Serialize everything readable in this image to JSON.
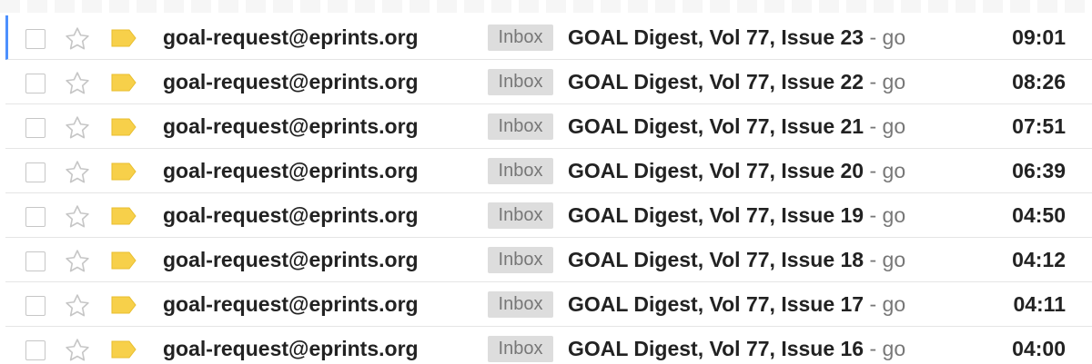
{
  "colors": {
    "star_outline": "#c6c6c6",
    "label_yellow": "#f7d04a",
    "selection_accent": "#4d90fe",
    "badge_bg": "#dddddd",
    "badge_text": "#777777"
  },
  "icons": {
    "checkbox": "checkbox-icon",
    "star": "star-icon",
    "label": "label-marker-icon"
  },
  "messages": [
    {
      "sender": "goal-request@eprints.org",
      "label": "Inbox",
      "subject": "GOAL Digest, Vol 77, Issue 23",
      "snippet": " - go",
      "time": "09:01",
      "selected": true
    },
    {
      "sender": "goal-request@eprints.org",
      "label": "Inbox",
      "subject": "GOAL Digest, Vol 77, Issue 22",
      "snippet": " - go",
      "time": "08:26",
      "selected": false
    },
    {
      "sender": "goal-request@eprints.org",
      "label": "Inbox",
      "subject": "GOAL Digest, Vol 77, Issue 21",
      "snippet": " - go",
      "time": "07:51",
      "selected": false
    },
    {
      "sender": "goal-request@eprints.org",
      "label": "Inbox",
      "subject": "GOAL Digest, Vol 77, Issue 20",
      "snippet": " - go",
      "time": "06:39",
      "selected": false
    },
    {
      "sender": "goal-request@eprints.org",
      "label": "Inbox",
      "subject": "GOAL Digest, Vol 77, Issue 19",
      "snippet": " - go",
      "time": "04:50",
      "selected": false
    },
    {
      "sender": "goal-request@eprints.org",
      "label": "Inbox",
      "subject": "GOAL Digest, Vol 77, Issue 18",
      "snippet": " - go",
      "time": "04:12",
      "selected": false
    },
    {
      "sender": "goal-request@eprints.org",
      "label": "Inbox",
      "subject": "GOAL Digest, Vol 77, Issue 17",
      "snippet": " - go",
      "time": "04:11",
      "selected": false
    },
    {
      "sender": "goal-request@eprints.org",
      "label": "Inbox",
      "subject": "GOAL Digest, Vol 77, Issue 16",
      "snippet": " - go",
      "time": "04:00",
      "selected": false
    }
  ]
}
